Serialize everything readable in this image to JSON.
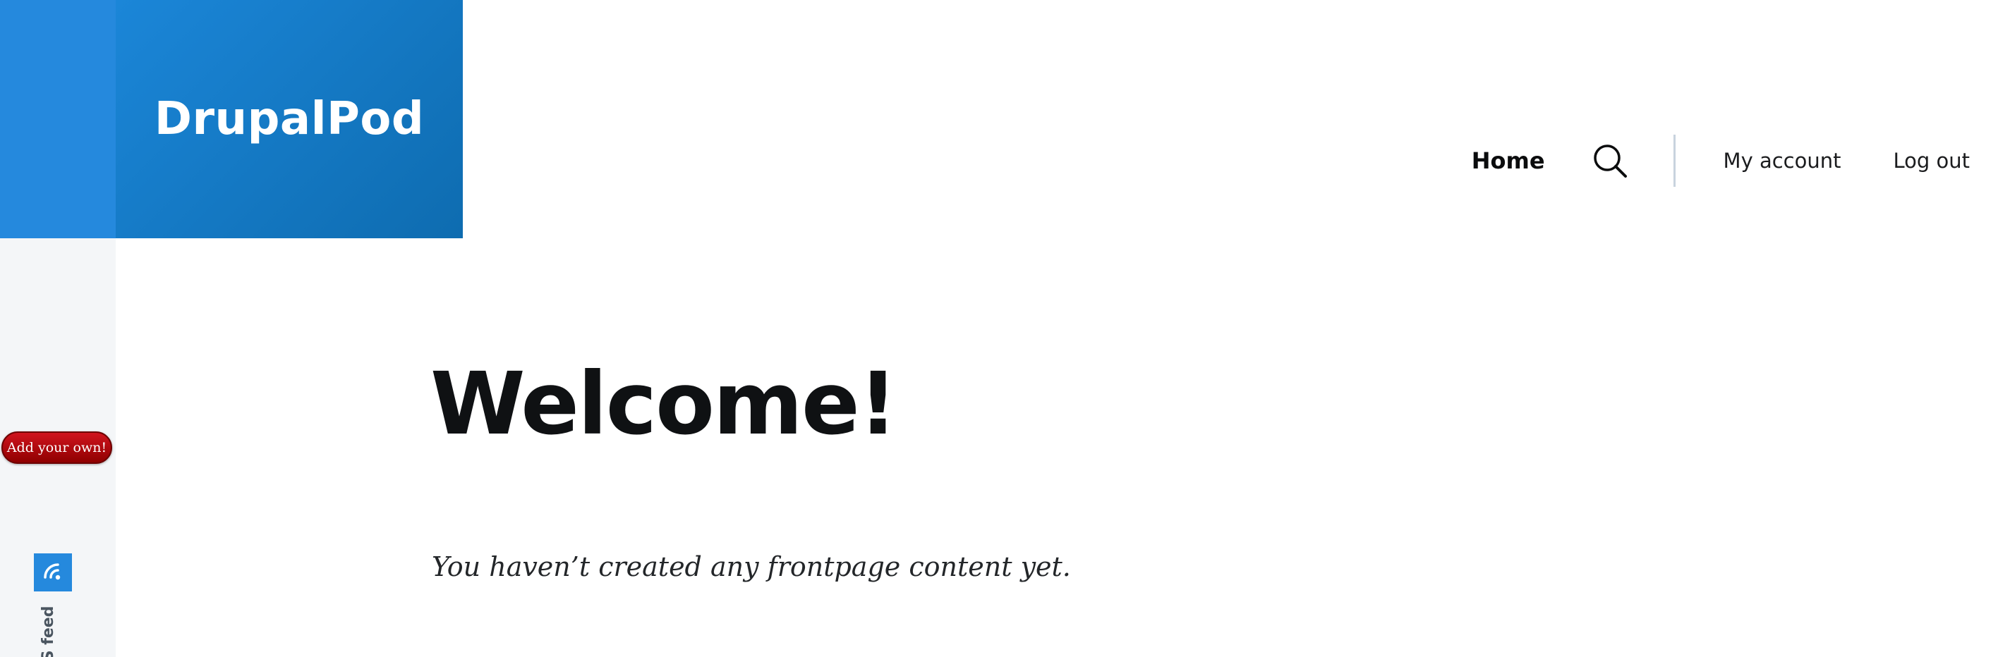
{
  "site": {
    "name": "DrupalPod"
  },
  "nav": {
    "home": "Home",
    "search_icon": "search-icon",
    "my_account": "My account",
    "log_out": "Log out"
  },
  "main": {
    "title": "Welcome!",
    "message": "You haven’t created any frontpage content yet."
  },
  "sidebar": {
    "add_your_own": "Add your own!",
    "rss_icon": "rss-icon",
    "rss_label": "RSS feed"
  },
  "colors": {
    "brand_blue": "#1b86d8",
    "rail_blue": "#2589dd",
    "rail_gray": "#f4f6f8",
    "add_button_red": "#c0101a",
    "divider": "#c8d3de"
  }
}
